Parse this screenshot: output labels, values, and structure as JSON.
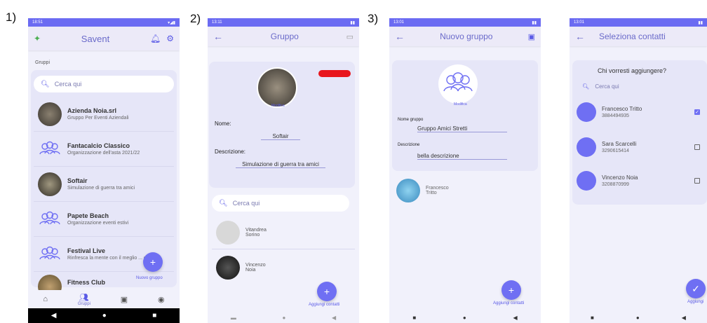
{
  "labels": {
    "s1": "1)",
    "s2": "2)",
    "s3": "3)"
  },
  "colors": {
    "accent": "#6f6ff3",
    "statusbar": "#6b6bf2",
    "appbar": "#eceaf8",
    "card": "#e6e6f8"
  },
  "screen1": {
    "time": "18:51",
    "title": "Savent",
    "section": "Gruppi",
    "search_placeholder": "Cerca qui",
    "groups": [
      {
        "name": "Azienda Noia.srl",
        "desc": "Gruppo Per Eventi Aziendali",
        "avatar": "photo"
      },
      {
        "name": "Fantacalcio Classico",
        "desc": "Organizzazione dell'asta 2021/22",
        "avatar": "group-icon"
      },
      {
        "name": "Softair",
        "desc": "Simulazione di guerra tra amici",
        "avatar": "photo"
      },
      {
        "name": "Papete Beach",
        "desc": "Organizzazione eventi estivi",
        "avatar": "group-icon"
      },
      {
        "name": "Festival Live",
        "desc": "Rinfresca la mente con il meglio ... e...",
        "avatar": "group-icon"
      },
      {
        "name": "Fitness Club",
        "desc": "",
        "avatar": "photo"
      }
    ],
    "fab_label": "Nuovo gruppo",
    "tab_active": "Gruppi"
  },
  "screen2": {
    "time": "13:11",
    "title": "Gruppo",
    "modify": "Modifica",
    "name_label": "Nome:",
    "name_value": "Softair",
    "desc_label": "Descrizione:",
    "desc_value": "Simulazione di guerra tra amici",
    "search_placeholder": "Cerca qui",
    "members": [
      {
        "first": "Vitandrea",
        "last": "Sorino"
      },
      {
        "first": "Vincenzo",
        "last": "Noia"
      }
    ],
    "fab_label": "Aggiungi contatti"
  },
  "screen3": {
    "time": "13:01",
    "title": "Nuovo gruppo",
    "modify": "Modifica",
    "name_label": "Nome gruppo",
    "name_value": "Gruppo Amici Stretti",
    "desc_label": "Descrizione",
    "desc_value": "bella descrizione",
    "member": {
      "first": "Francesco",
      "last": "Tritto"
    },
    "fab_label": "Aggiungi contatti"
  },
  "screen4": {
    "time": "13:01",
    "title": "Seleziona contatti",
    "question": "Chi vorresti aggiungere?",
    "search_placeholder": "Cerca qui",
    "contacts": [
      {
        "name": "Francesco Tritto",
        "phone": "3884494935",
        "checked": true
      },
      {
        "name": "Sara Scarcelli",
        "phone": "3290615414",
        "checked": false
      },
      {
        "name": "Vincenzo Noia",
        "phone": "3208870999",
        "checked": false
      }
    ],
    "fab_label": "Aggiungi"
  }
}
